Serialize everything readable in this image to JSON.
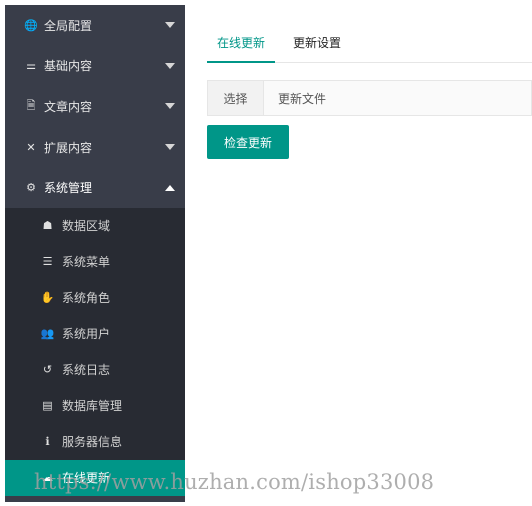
{
  "sidebar": {
    "items": [
      {
        "label": "全局配置",
        "icon": "globe-icon",
        "glyph": "🌐"
      },
      {
        "label": "基础内容",
        "icon": "sliders-icon",
        "glyph": "⚌"
      },
      {
        "label": "文章内容",
        "icon": "file-icon",
        "glyph": "🗎"
      },
      {
        "label": "扩展内容",
        "icon": "expand-icon",
        "glyph": "✕"
      },
      {
        "label": "系统管理",
        "icon": "gear-icon",
        "glyph": "⚙"
      }
    ],
    "sub_items": [
      {
        "label": "数据区域",
        "icon": "sitemap-icon",
        "glyph": "☗"
      },
      {
        "label": "系统菜单",
        "icon": "menu-icon",
        "glyph": "☰"
      },
      {
        "label": "系统角色",
        "icon": "hand-icon",
        "glyph": "✋"
      },
      {
        "label": "系统用户",
        "icon": "users-icon",
        "glyph": "👥"
      },
      {
        "label": "系统日志",
        "icon": "history-icon",
        "glyph": "↺"
      },
      {
        "label": "数据库管理",
        "icon": "database-icon",
        "glyph": "▤"
      },
      {
        "label": "服务器信息",
        "icon": "info-icon",
        "glyph": "ℹ"
      },
      {
        "label": "在线更新",
        "icon": "upload-icon",
        "glyph": "☁"
      }
    ]
  },
  "tabs": {
    "online_update": "在线更新",
    "update_settings": "更新设置"
  },
  "file_input": {
    "choose_label": "选择",
    "file_label": "更新文件"
  },
  "check_button": "检查更新",
  "watermark": "https://www.huzhan.com/ishop33008",
  "colors": {
    "sidebar_bg": "#393d49",
    "subnav_bg": "#282b33",
    "accent": "#009688"
  }
}
